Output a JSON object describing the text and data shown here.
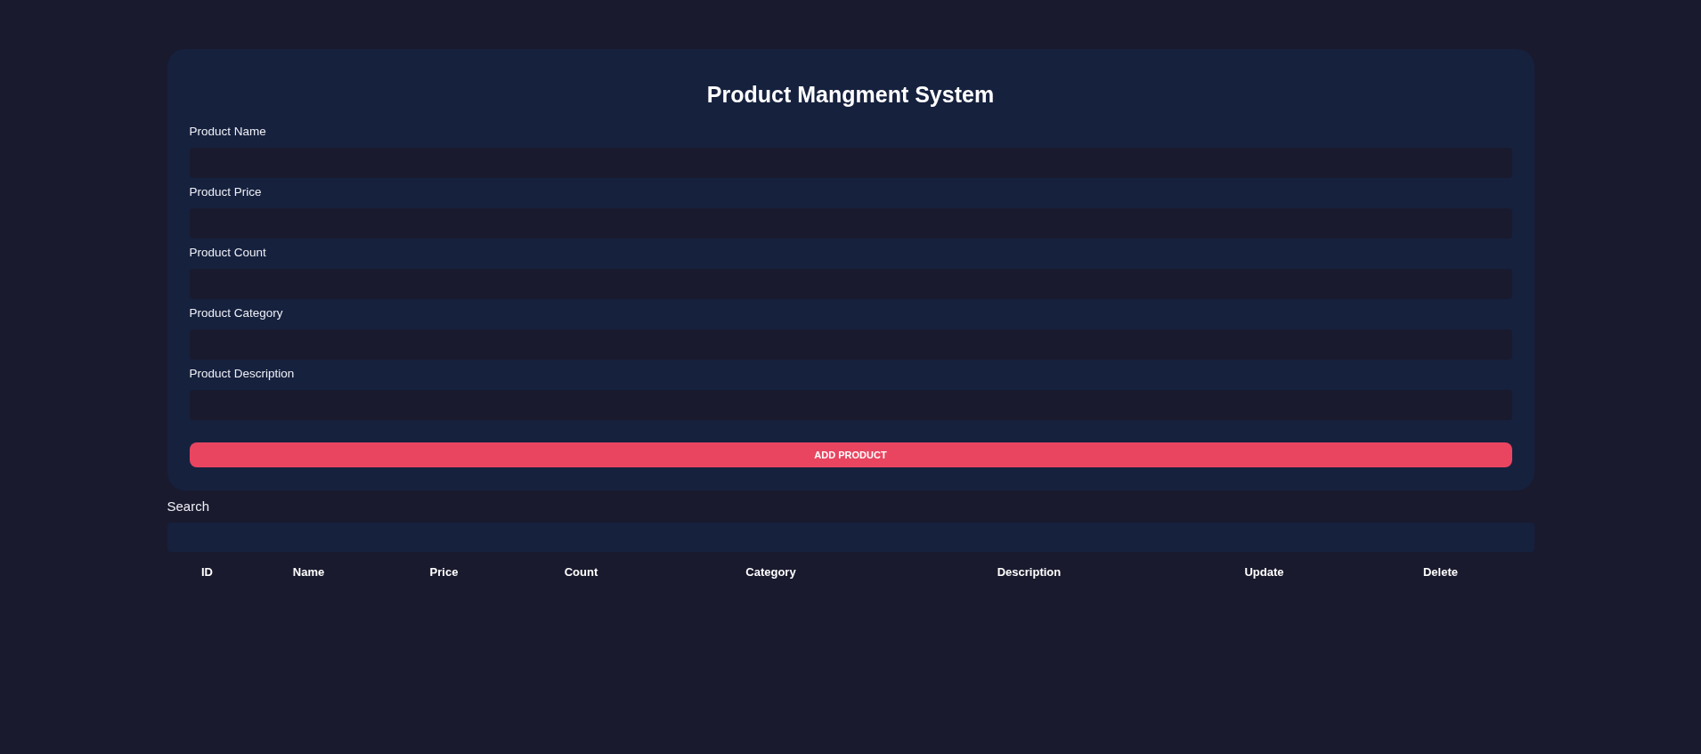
{
  "form": {
    "title": "Product Mangment System",
    "fields": [
      {
        "label": "Product Name"
      },
      {
        "label": "Product Price"
      },
      {
        "label": "Product Count"
      },
      {
        "label": "Product Category"
      },
      {
        "label": "Product Description"
      }
    ],
    "submit_button": "ADD PRODUCT"
  },
  "search": {
    "label": "Search"
  },
  "table": {
    "columns": [
      "ID",
      "Name",
      "Price",
      "Count",
      "Category",
      "Description",
      "Update",
      "Delete"
    ]
  }
}
